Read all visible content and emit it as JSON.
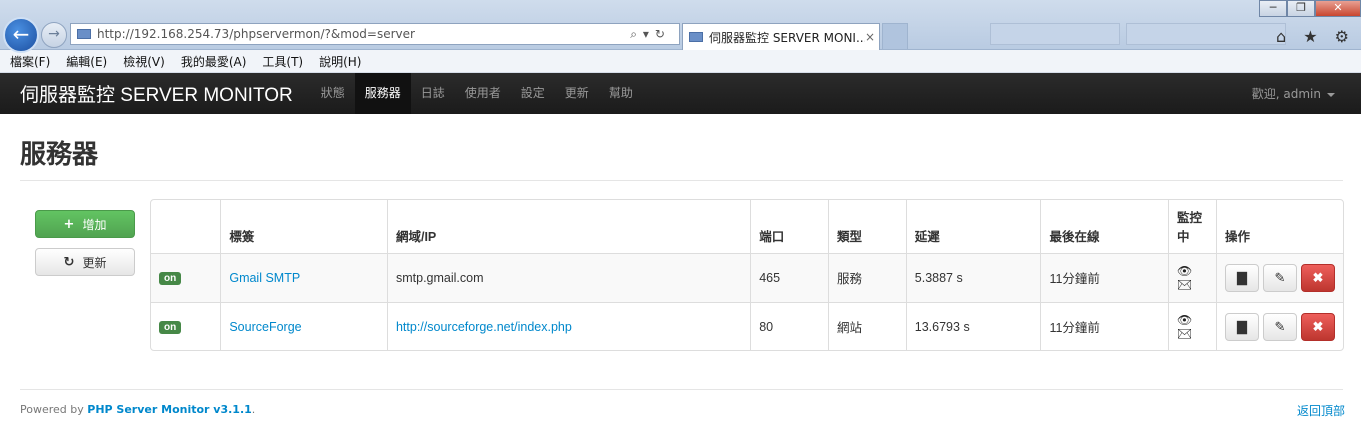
{
  "browser": {
    "url": "http://192.168.254.73/phpservermon/?&mod=server",
    "tab_title": "伺服器監控 SERVER MONI...",
    "tab_close": "×",
    "window_buttons": [
      "─",
      "❐",
      "✕"
    ],
    "right_icons": "⌂ ★ ⚙"
  },
  "menubar": [
    "檔案(F)",
    "編輯(E)",
    "檢視(V)",
    "我的最愛(A)",
    "工具(T)",
    "說明(H)"
  ],
  "navbar": {
    "brand": "伺服器監控 SERVER MONITOR",
    "items": [
      "狀態",
      "服務器",
      "日誌",
      "使用者",
      "設定",
      "更新",
      "幫助"
    ],
    "active": "服務器",
    "welcome": "歡迎, admin"
  },
  "page": {
    "title": "服務器"
  },
  "buttons": {
    "add": "增加",
    "update": "更新"
  },
  "table": {
    "headers": [
      "",
      "標簽",
      "網域/IP",
      "端口",
      "類型",
      "延遲",
      "最後在線",
      "監控中",
      "操作"
    ],
    "rows": [
      {
        "status": "on",
        "label": "Gmail SMTP",
        "domain": "smtp.gmail.com",
        "domain_link": false,
        "port": "465",
        "type": "服務",
        "latency": "5.3887 s",
        "last_online": "11分鐘前"
      },
      {
        "status": "on",
        "label": "SourceForge",
        "domain": "http://sourceforge.net/index.php",
        "domain_link": true,
        "port": "80",
        "type": "網站",
        "latency": "13.6793 s",
        "last_online": "11分鐘前"
      }
    ]
  },
  "footer": {
    "powered_prefix": "Powered by ",
    "powered_link": "PHP Server Monitor v3.1.1",
    "powered_suffix": ".",
    "back_to_top": "返回頂部"
  },
  "colors": {
    "success": "#51a351",
    "danger": "#bd362f",
    "link": "#0088cc",
    "navbar": "#1b1b1b"
  }
}
